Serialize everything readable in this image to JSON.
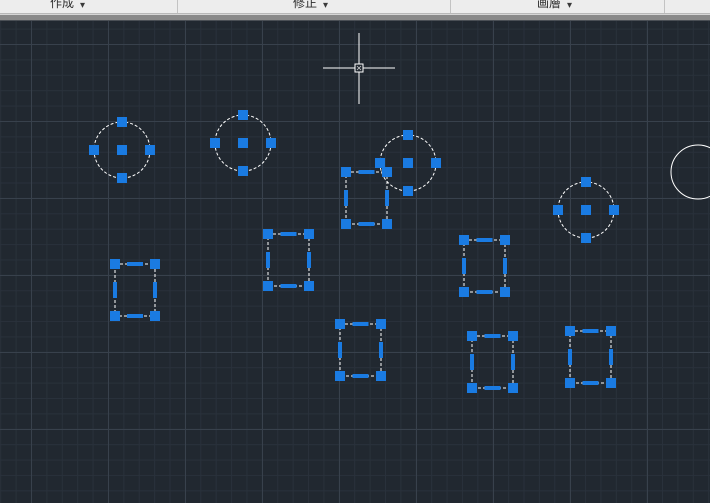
{
  "ribbon": {
    "panels": [
      {
        "label": "作成",
        "arrow": "▾"
      },
      {
        "label": "修正",
        "arrow": "▾"
      },
      {
        "label": "画層",
        "arrow": "▾"
      }
    ]
  },
  "colors": {
    "canvas_background": "#212830",
    "grip": "#1a7be2",
    "selection_outline": "#ffffff",
    "object_outline": "#ffffff"
  },
  "icons": {
    "cursor": "crosshair-cursor-icon",
    "dropdown": "chevron-down-icon",
    "grip": "grip-icon"
  }
}
